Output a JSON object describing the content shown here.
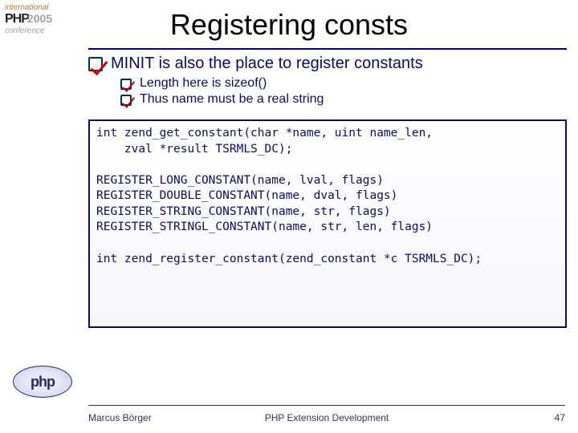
{
  "logo_top": {
    "line1": "international",
    "line2a": "PHP",
    "line2b": "2005",
    "line3": "conference"
  },
  "logo_bottom": "php",
  "title": "Registering consts",
  "main_bullet": "MINIT is also the place to register constants",
  "sub_bullets": [
    "Length here is sizeof()",
    "Thus name must be a real string"
  ],
  "code": "int zend_get_constant(char *name, uint name_len,\n    zval *result TSRMLS_DC);\n\nREGISTER_LONG_CONSTANT(name, lval, flags)\nREGISTER_DOUBLE_CONSTANT(name, dval, flags)\nREGISTER_STRING_CONSTANT(name, str, flags)\nREGISTER_STRINGL_CONSTANT(name, str, len, flags)\n\nint zend_register_constant(zend_constant *c TSRMLS_DC);",
  "footer": {
    "author": "Marcus Börger",
    "title": "PHP Extension Development",
    "page": "47"
  }
}
